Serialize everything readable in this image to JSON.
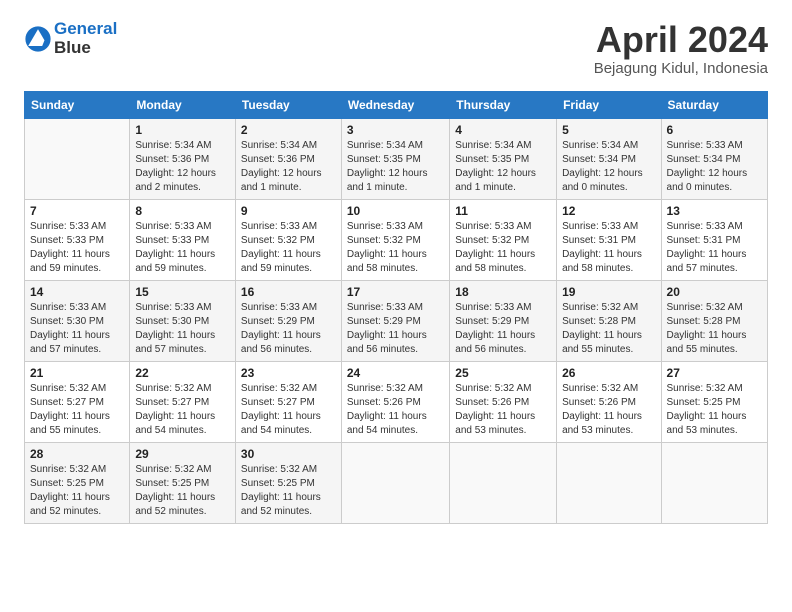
{
  "header": {
    "logo_line1": "General",
    "logo_line2": "Blue",
    "month_title": "April 2024",
    "location": "Bejagung Kidul, Indonesia"
  },
  "weekdays": [
    "Sunday",
    "Monday",
    "Tuesday",
    "Wednesday",
    "Thursday",
    "Friday",
    "Saturday"
  ],
  "weeks": [
    [
      {
        "day": "",
        "info": ""
      },
      {
        "day": "1",
        "info": "Sunrise: 5:34 AM\nSunset: 5:36 PM\nDaylight: 12 hours\nand 2 minutes."
      },
      {
        "day": "2",
        "info": "Sunrise: 5:34 AM\nSunset: 5:36 PM\nDaylight: 12 hours\nand 1 minute."
      },
      {
        "day": "3",
        "info": "Sunrise: 5:34 AM\nSunset: 5:35 PM\nDaylight: 12 hours\nand 1 minute."
      },
      {
        "day": "4",
        "info": "Sunrise: 5:34 AM\nSunset: 5:35 PM\nDaylight: 12 hours\nand 1 minute."
      },
      {
        "day": "5",
        "info": "Sunrise: 5:34 AM\nSunset: 5:34 PM\nDaylight: 12 hours\nand 0 minutes."
      },
      {
        "day": "6",
        "info": "Sunrise: 5:33 AM\nSunset: 5:34 PM\nDaylight: 12 hours\nand 0 minutes."
      }
    ],
    [
      {
        "day": "7",
        "info": "Sunrise: 5:33 AM\nSunset: 5:33 PM\nDaylight: 11 hours\nand 59 minutes."
      },
      {
        "day": "8",
        "info": "Sunrise: 5:33 AM\nSunset: 5:33 PM\nDaylight: 11 hours\nand 59 minutes."
      },
      {
        "day": "9",
        "info": "Sunrise: 5:33 AM\nSunset: 5:32 PM\nDaylight: 11 hours\nand 59 minutes."
      },
      {
        "day": "10",
        "info": "Sunrise: 5:33 AM\nSunset: 5:32 PM\nDaylight: 11 hours\nand 58 minutes."
      },
      {
        "day": "11",
        "info": "Sunrise: 5:33 AM\nSunset: 5:32 PM\nDaylight: 11 hours\nand 58 minutes."
      },
      {
        "day": "12",
        "info": "Sunrise: 5:33 AM\nSunset: 5:31 PM\nDaylight: 11 hours\nand 58 minutes."
      },
      {
        "day": "13",
        "info": "Sunrise: 5:33 AM\nSunset: 5:31 PM\nDaylight: 11 hours\nand 57 minutes."
      }
    ],
    [
      {
        "day": "14",
        "info": "Sunrise: 5:33 AM\nSunset: 5:30 PM\nDaylight: 11 hours\nand 57 minutes."
      },
      {
        "day": "15",
        "info": "Sunrise: 5:33 AM\nSunset: 5:30 PM\nDaylight: 11 hours\nand 57 minutes."
      },
      {
        "day": "16",
        "info": "Sunrise: 5:33 AM\nSunset: 5:29 PM\nDaylight: 11 hours\nand 56 minutes."
      },
      {
        "day": "17",
        "info": "Sunrise: 5:33 AM\nSunset: 5:29 PM\nDaylight: 11 hours\nand 56 minutes."
      },
      {
        "day": "18",
        "info": "Sunrise: 5:33 AM\nSunset: 5:29 PM\nDaylight: 11 hours\nand 56 minutes."
      },
      {
        "day": "19",
        "info": "Sunrise: 5:32 AM\nSunset: 5:28 PM\nDaylight: 11 hours\nand 55 minutes."
      },
      {
        "day": "20",
        "info": "Sunrise: 5:32 AM\nSunset: 5:28 PM\nDaylight: 11 hours\nand 55 minutes."
      }
    ],
    [
      {
        "day": "21",
        "info": "Sunrise: 5:32 AM\nSunset: 5:27 PM\nDaylight: 11 hours\nand 55 minutes."
      },
      {
        "day": "22",
        "info": "Sunrise: 5:32 AM\nSunset: 5:27 PM\nDaylight: 11 hours\nand 54 minutes."
      },
      {
        "day": "23",
        "info": "Sunrise: 5:32 AM\nSunset: 5:27 PM\nDaylight: 11 hours\nand 54 minutes."
      },
      {
        "day": "24",
        "info": "Sunrise: 5:32 AM\nSunset: 5:26 PM\nDaylight: 11 hours\nand 54 minutes."
      },
      {
        "day": "25",
        "info": "Sunrise: 5:32 AM\nSunset: 5:26 PM\nDaylight: 11 hours\nand 53 minutes."
      },
      {
        "day": "26",
        "info": "Sunrise: 5:32 AM\nSunset: 5:26 PM\nDaylight: 11 hours\nand 53 minutes."
      },
      {
        "day": "27",
        "info": "Sunrise: 5:32 AM\nSunset: 5:25 PM\nDaylight: 11 hours\nand 53 minutes."
      }
    ],
    [
      {
        "day": "28",
        "info": "Sunrise: 5:32 AM\nSunset: 5:25 PM\nDaylight: 11 hours\nand 52 minutes."
      },
      {
        "day": "29",
        "info": "Sunrise: 5:32 AM\nSunset: 5:25 PM\nDaylight: 11 hours\nand 52 minutes."
      },
      {
        "day": "30",
        "info": "Sunrise: 5:32 AM\nSunset: 5:25 PM\nDaylight: 11 hours\nand 52 minutes."
      },
      {
        "day": "",
        "info": ""
      },
      {
        "day": "",
        "info": ""
      },
      {
        "day": "",
        "info": ""
      },
      {
        "day": "",
        "info": ""
      }
    ]
  ]
}
